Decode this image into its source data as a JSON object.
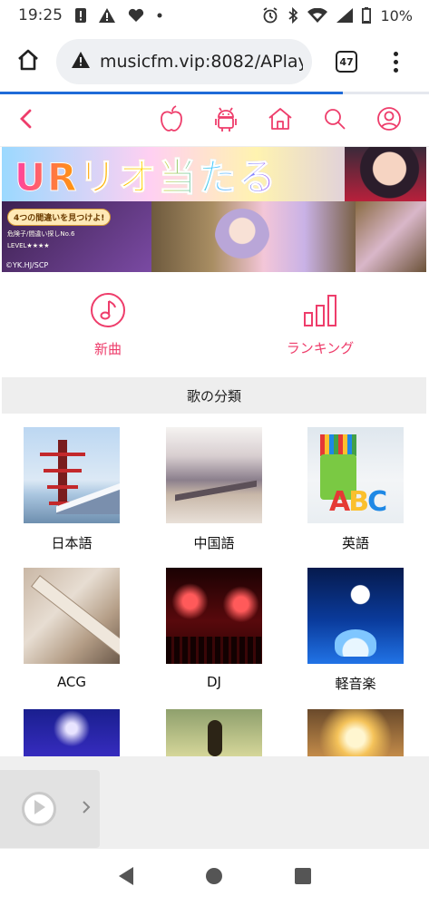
{
  "status_bar": {
    "time": "19:25",
    "battery": "10%",
    "icons": [
      "alert-badge-icon",
      "warning-icon",
      "heart-icon",
      "dot-icon",
      "alarm-icon",
      "bluetooth-icon",
      "wifi-icon",
      "signal-icon",
      "battery-icon"
    ]
  },
  "browser": {
    "url": "musicfm.vip:8082/APlay",
    "tab_count": "47",
    "progress": 0.8
  },
  "app_nav": {
    "icons": [
      "apple-icon",
      "android-icon",
      "home-icon",
      "search-icon",
      "user-icon"
    ],
    "accent": "#ee3d6b"
  },
  "banner": {
    "top_text": "URリオ当たる",
    "pill_text": "4つの間違いを見つけよ!",
    "sub_text": "危険子/間違い探しNo.6",
    "level_text": "LEVEL★★★★",
    "copyright": "©YK.HJ/SCP"
  },
  "features": [
    {
      "label": "新曲",
      "icon": "music-note-icon"
    },
    {
      "label": "ランキング",
      "icon": "bar-chart-icon"
    }
  ],
  "section_title": "歌の分類",
  "categories": [
    {
      "label": "日本語"
    },
    {
      "label": "中国語"
    },
    {
      "label": "英語"
    },
    {
      "label": "ACG"
    },
    {
      "label": "DJ"
    },
    {
      "label": "軽音楽"
    },
    {
      "label": ""
    },
    {
      "label": ""
    },
    {
      "label": ""
    }
  ],
  "english_tile_letters": "ABC"
}
